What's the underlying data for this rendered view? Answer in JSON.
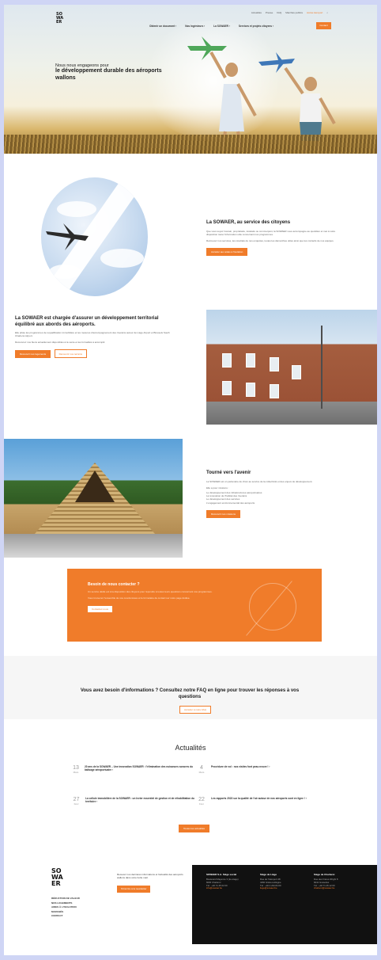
{
  "header": {
    "logo_lines": [
      "SO",
      "WA",
      "ER"
    ],
    "top_links": [
      "Actualités",
      "Presse",
      "FAQ",
      "Marchés publics"
    ],
    "top_accent": "Accès Aéroport",
    "main_nav": [
      "Obtenir un document ›",
      "Nos Ingénieurs ›",
      "La SOWAER ›",
      "Services et projets citoyens ›"
    ],
    "contact": "Contact"
  },
  "hero": {
    "pre_title": "Nous nous engageons pour",
    "title": "le développement durable des aéroports wallons"
  },
  "section_citizens": {
    "title": "La SOWAER, au service des citoyens",
    "text1": "Que vous soyez riverain, propriétaire, locataire ou commerçant, la SOWAER vous accompagne au quotidien et met à votre disposition toute l'information utile concernant nos programmes.",
    "text2": "Retrouvez nos services, les résultats de nos enquêtes, toutes les démarches utiles ainsi que les contacts de nos équipes.",
    "button": "Accéder aux aides à l'isolation"
  },
  "section_territory": {
    "title": "La SOWAER est chargée d'assurer un développement territorial équilibré aux abords des aéroports.",
    "text1": "Elle pilote les programmes de requalification immobilière et les mesures d'accompagnement des riverains autour de Liège Airport et Brussels South Charleroi Airport.",
    "text2": "Découvrez nos biens actuellement disponibles à la vente et les formalités à accomplir.",
    "button1": "Découvrir nos logements",
    "button2": "Découvrir nos terrains"
  },
  "section_future": {
    "title": "Tourné vers l'avenir",
    "text1": "La SOWAER est un partenaire de choix au service de la collectivité et des enjeux de développement.",
    "list_intro": "Elle a pour missions :",
    "list": [
      "Le développement des infrastructures aéroportuaires",
      "La rénovation de l'habitat des riverains",
      "Le développement des services",
      "L'engagement environnemental des aéroports"
    ],
    "button": "Découvrir nos missions"
  },
  "cta": {
    "title": "Besoin de nous contacter ?",
    "text1": "Un service dédié est à la disposition des citoyens pour répondre à toutes leurs questions concernant nos programmes.",
    "text2": "Vous trouverez l'ensemble de nos coordonnées et le formulaire de contact sur notre page dédiée.",
    "button": "Contactez-nous"
  },
  "faq": {
    "title": "Vous avez besoin d'informations ? Consultez notre FAQ en ligne pour trouver les réponses à vos questions",
    "button": "Accéder à notre FAQ"
  },
  "news": {
    "title": "Actualités",
    "items": [
      {
        "day": "13",
        "month": "Mars",
        "text": "20 ans de la SOWAER – Une innovation SOWAER : l'élimination des nuisances sonores du balisage aéroportuaire ›"
      },
      {
        "day": "4",
        "month": "Mars",
        "text": "Procédure de vol : nos visites font peau neuve ! ›"
      },
      {
        "day": "27",
        "month": "Févr",
        "text": "La cellule immobilière de la SOWAER : un levier essentiel de gestion et de réhabilitation du territoire ›"
      },
      {
        "day": "22",
        "month": "Févr",
        "text": "Les rapports 2023 sur la qualité de l'air autour de nos aéroports sont en ligne ! ›"
      }
    ],
    "button": "Toutes les actualités"
  },
  "footer": {
    "logo_lines": [
      "SO",
      "WA",
      "ER"
    ],
    "links": [
      "RÉDUCTION DE VALEUR",
      "NOS LOGEMENTS",
      "AIDES À L'ISOLATION",
      "MARCHÉS",
      "CONTACT"
    ],
    "newsletter_text": "Recevez nos dernières informations et l'actualité des aéroports wallons dans votre boîte mail.",
    "newsletter_button": "S'inscrire à la newsletter",
    "columns": [
      {
        "head": "SOWAER S.A. Siège social",
        "lines": [
          "Boulevard Mayence 3 (2e étage)",
          "6000 Charleroi",
          "Tél : +32 71 25 02 00"
        ],
        "link": "info@sowaer.be"
      },
      {
        "head": "Siège de Liège",
        "lines": [
          "Rue de l'Aéroport 48",
          "4460 Grâce-Hollogne",
          "Tél : +32 4 234 84 00"
        ],
        "link": "liege@sowaer.be"
      },
      {
        "head": "Siège de Charleroi",
        "lines": [
          "Rue des Frères Wright 8",
          "6041 Gosselies",
          "Tél : +32 71 25 12 00"
        ],
        "link": "charleroi@sowaer.be"
      }
    ]
  },
  "colors": {
    "accent": "#f07c2a",
    "dark": "#111111"
  }
}
